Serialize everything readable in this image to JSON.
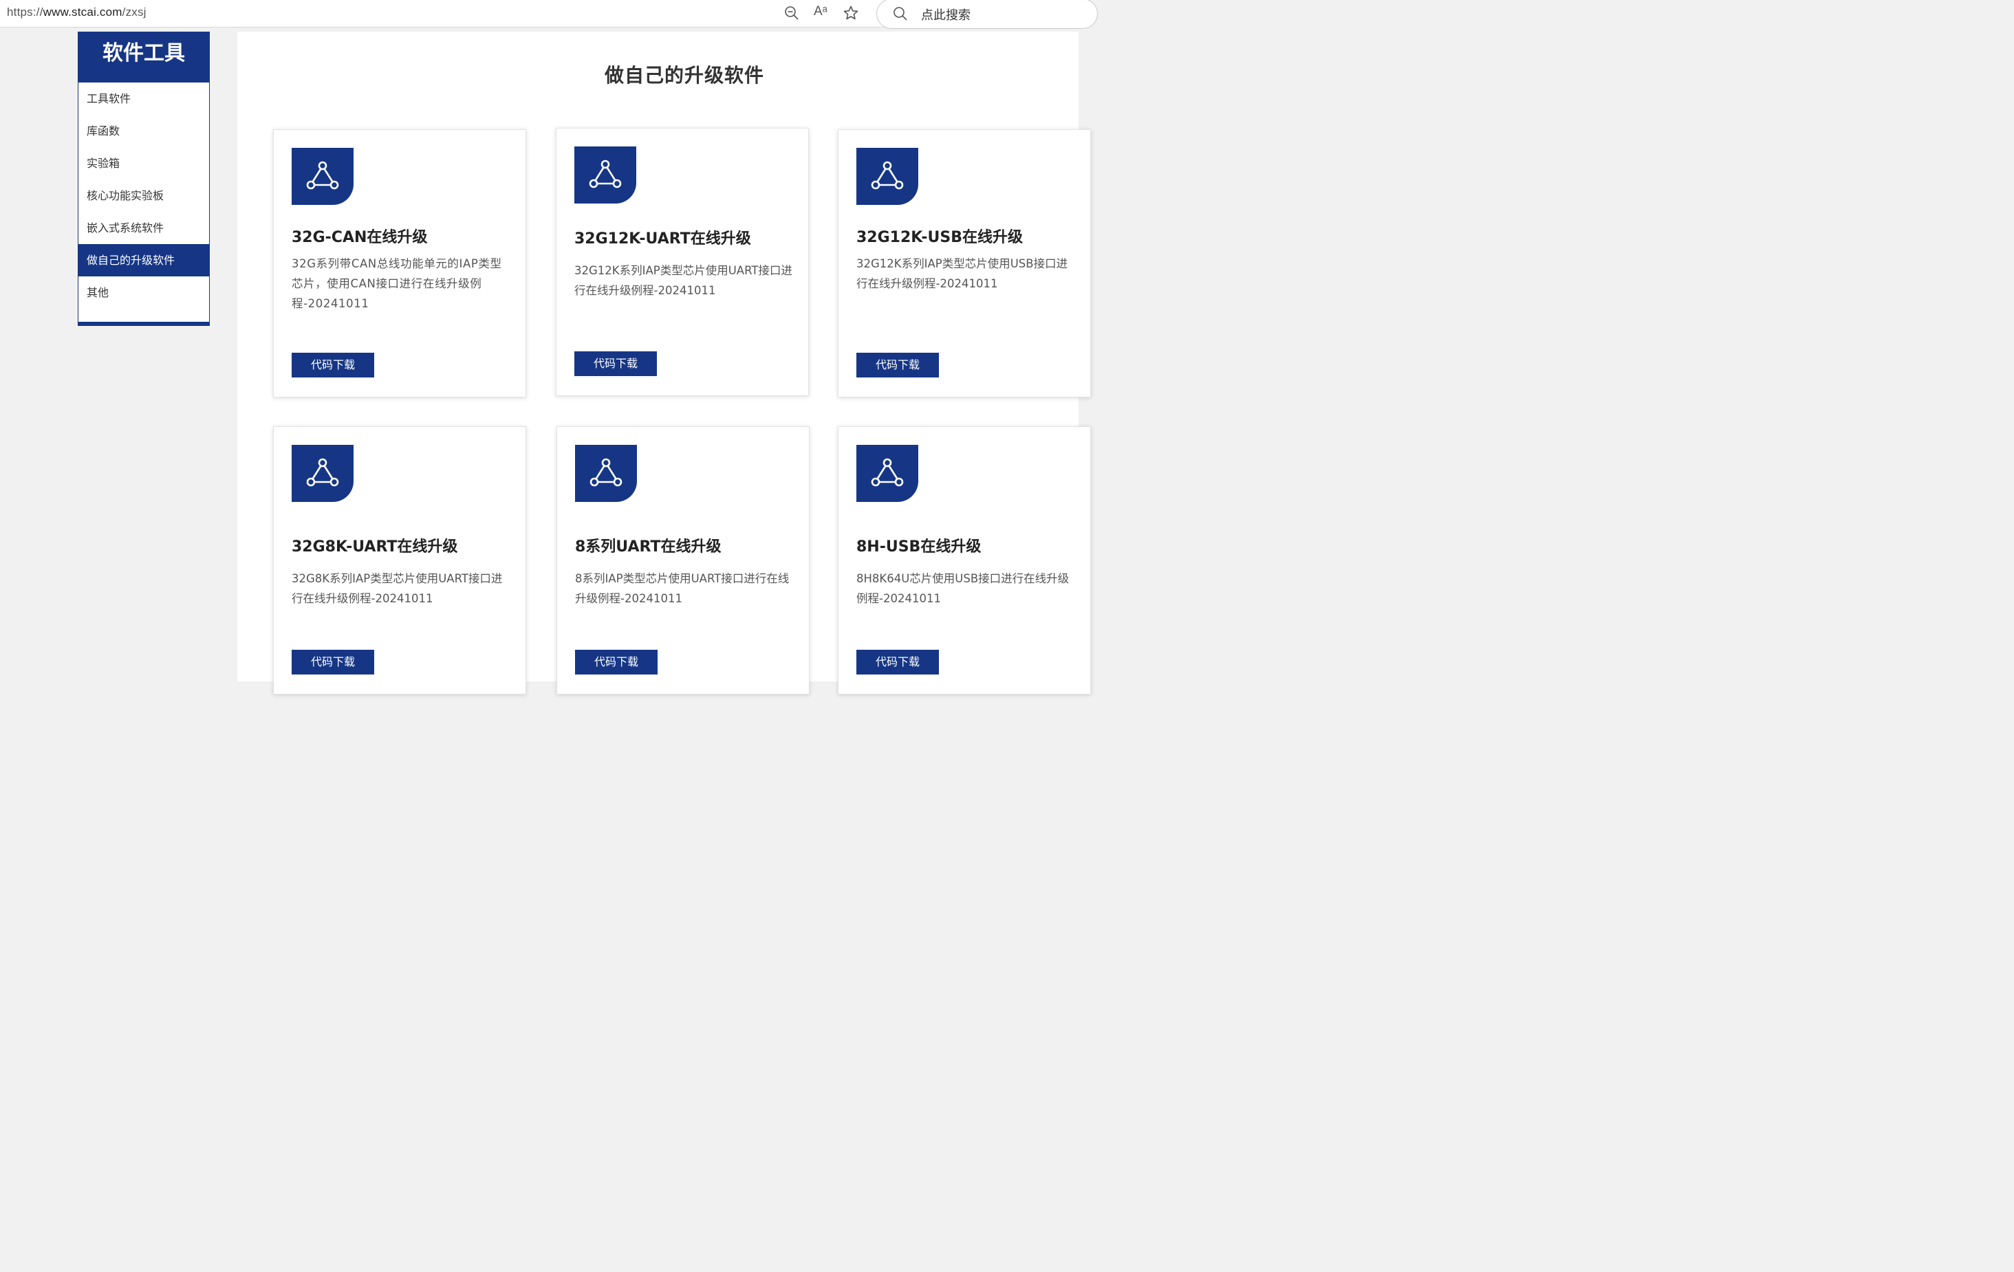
{
  "browser": {
    "url_scheme": "https://",
    "url_host": "www.stcai.com",
    "url_path": "/zxsj",
    "search_placeholder": "点此搜索",
    "read_aloud_label": "Aᵃ"
  },
  "sidebar": {
    "title": "软件工具",
    "items": [
      {
        "label": "工具软件"
      },
      {
        "label": "库函数"
      },
      {
        "label": "实验箱"
      },
      {
        "label": "核心功能实验板"
      },
      {
        "label": "嵌入式系统软件"
      },
      {
        "label": "做自己的升级软件",
        "active": true
      },
      {
        "label": "其他"
      }
    ]
  },
  "main": {
    "title": "做自己的升级软件",
    "cards": [
      {
        "title": "32G-CAN在线升级",
        "desc": "32G系列带CAN总线功能单元的IAP类型芯片，使用CAN接口进行在线升级例程-20241011",
        "button": "代码下载"
      },
      {
        "title": "32G12K-UART在线升级",
        "desc": "32G12K系列IAP类型芯片使用UART接口进行在线升级例程-20241011",
        "button": "代码下载"
      },
      {
        "title": "32G12K-USB在线升级",
        "desc": "32G12K系列IAP类型芯片使用USB接口进行在线升级例程-20241011",
        "button": "代码下载"
      },
      {
        "title": "32G8K-UART在线升级",
        "desc": "32G8K系列IAP类型芯片使用UART接口进行在线升级例程-20241011",
        "button": "代码下载"
      },
      {
        "title": "8系列UART在线升级",
        "desc": "8系列IAP类型芯片使用UART接口进行在线升级例程-20241011",
        "button": "代码下载"
      },
      {
        "title": "8H-USB在线升级",
        "desc": "8H8K64U芯片使用USB接口进行在线升级例程-20241011",
        "button": "代码下载"
      }
    ]
  },
  "colors": {
    "brand_blue": "#163685",
    "page_bg": "#f1f1f1",
    "card_bg": "#ffffff"
  },
  "icons": {
    "card_icon": "network-triangle-icon",
    "zoom": "zoom-out-icon",
    "read_aloud": "read-aloud-icon",
    "favorite": "star-icon",
    "search": "search-icon"
  }
}
